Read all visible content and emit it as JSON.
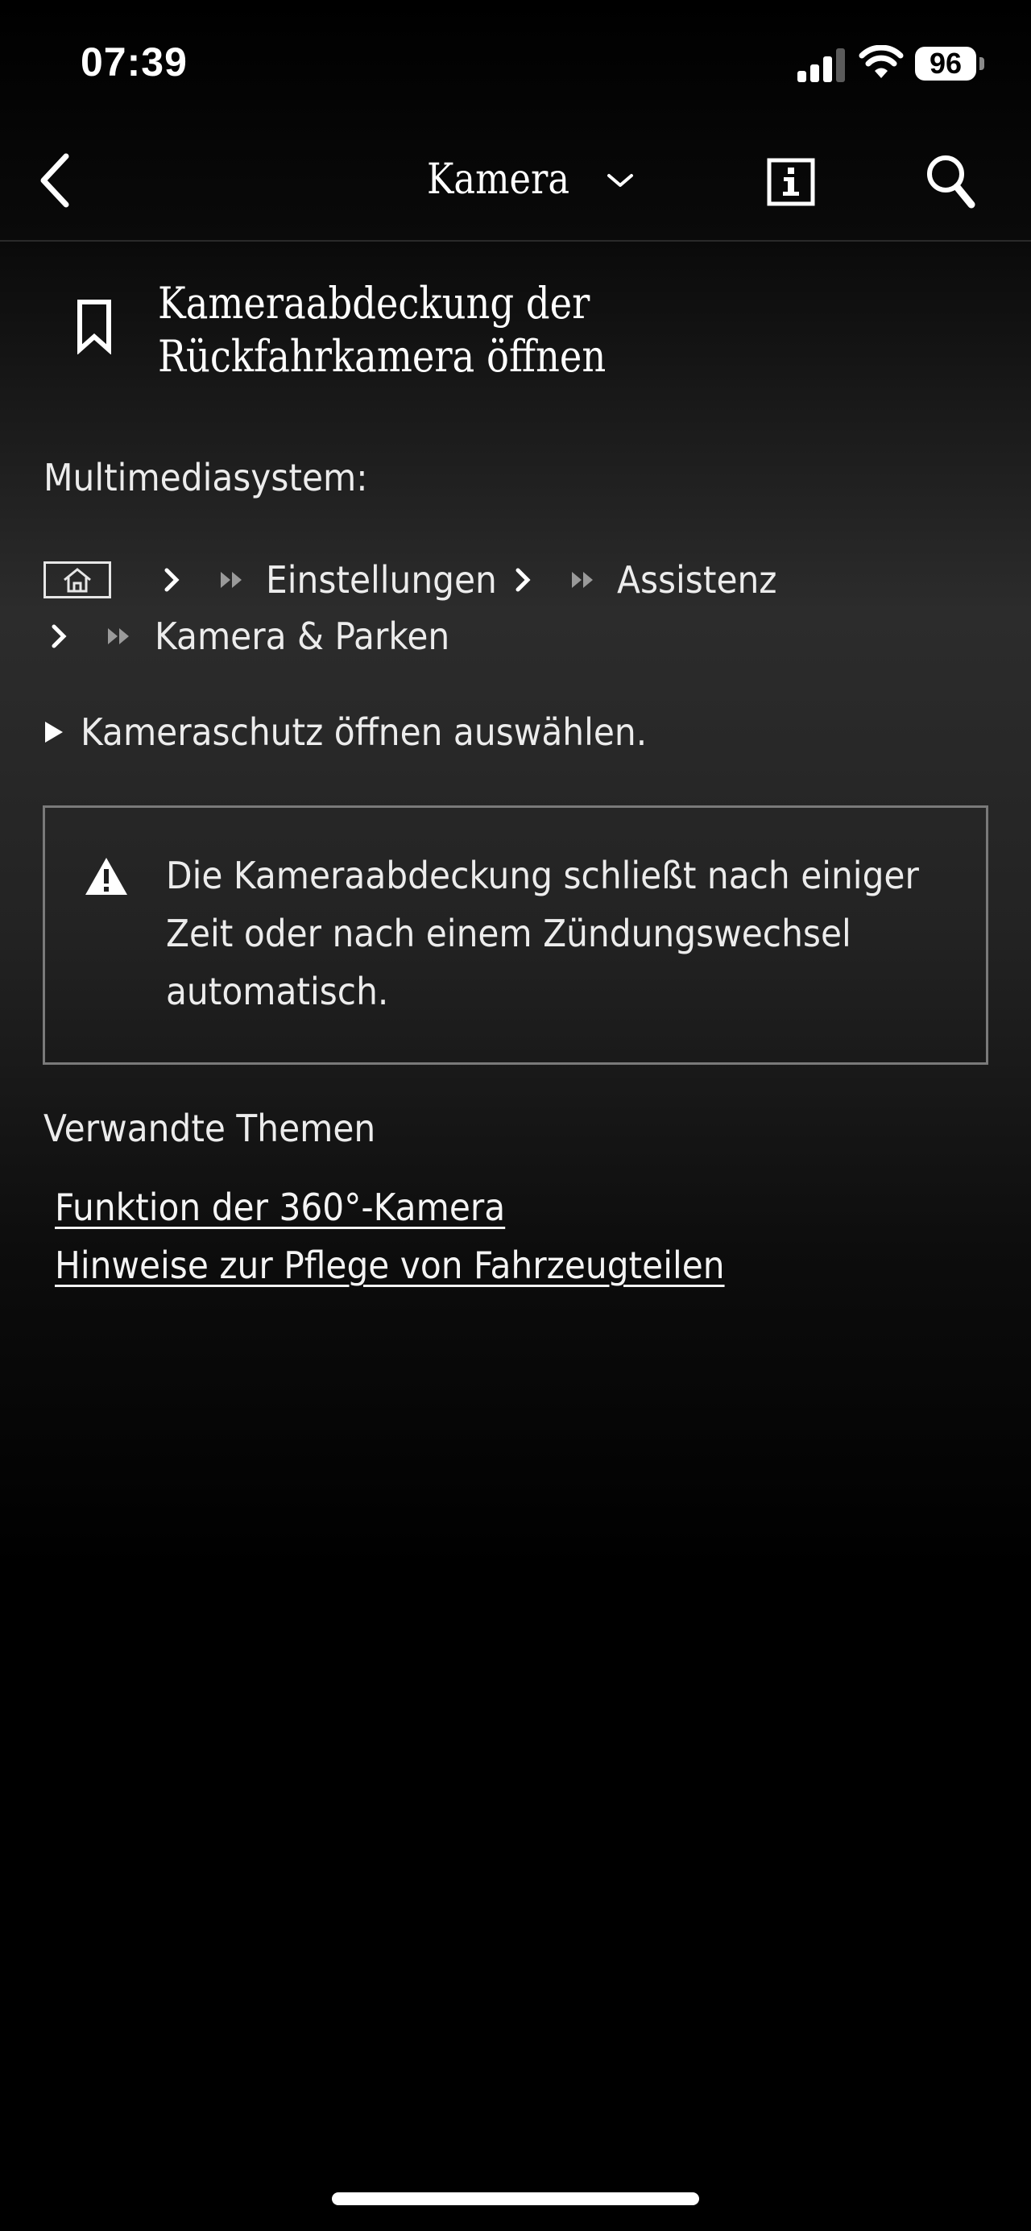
{
  "status_bar": {
    "time": "07:39",
    "battery": "96"
  },
  "nav": {
    "title": "Kamera",
    "icons": {
      "back": "chevron-left-icon",
      "dropdown": "chevron-down-icon",
      "info": "info-icon",
      "search": "search-icon"
    }
  },
  "article": {
    "title_line1": "Kameraabdeckung der",
    "title_line2": "Rückfahrkamera öffnen",
    "section_label": "Multimediasystem:",
    "breadcrumb": {
      "items": [
        "Einstellungen",
        "Assistenz",
        "Kamera & Parken"
      ]
    },
    "step": "Kameraschutz öffnen auswählen.",
    "warning": {
      "line1": "Die Kameraabdeckung schließt nach einiger",
      "line2": "Zeit oder nach einem Zündungswechsel",
      "line3": "automatisch."
    }
  },
  "related": {
    "title": "Verwandte Themen",
    "links": [
      "Funktion der 360°-Kamera",
      "Hinweise zur Pflege von Fahrzeugteilen"
    ]
  },
  "colors": {
    "background": "#000000",
    "text": "#ffffff",
    "warning_border": "#7a7a7a"
  }
}
